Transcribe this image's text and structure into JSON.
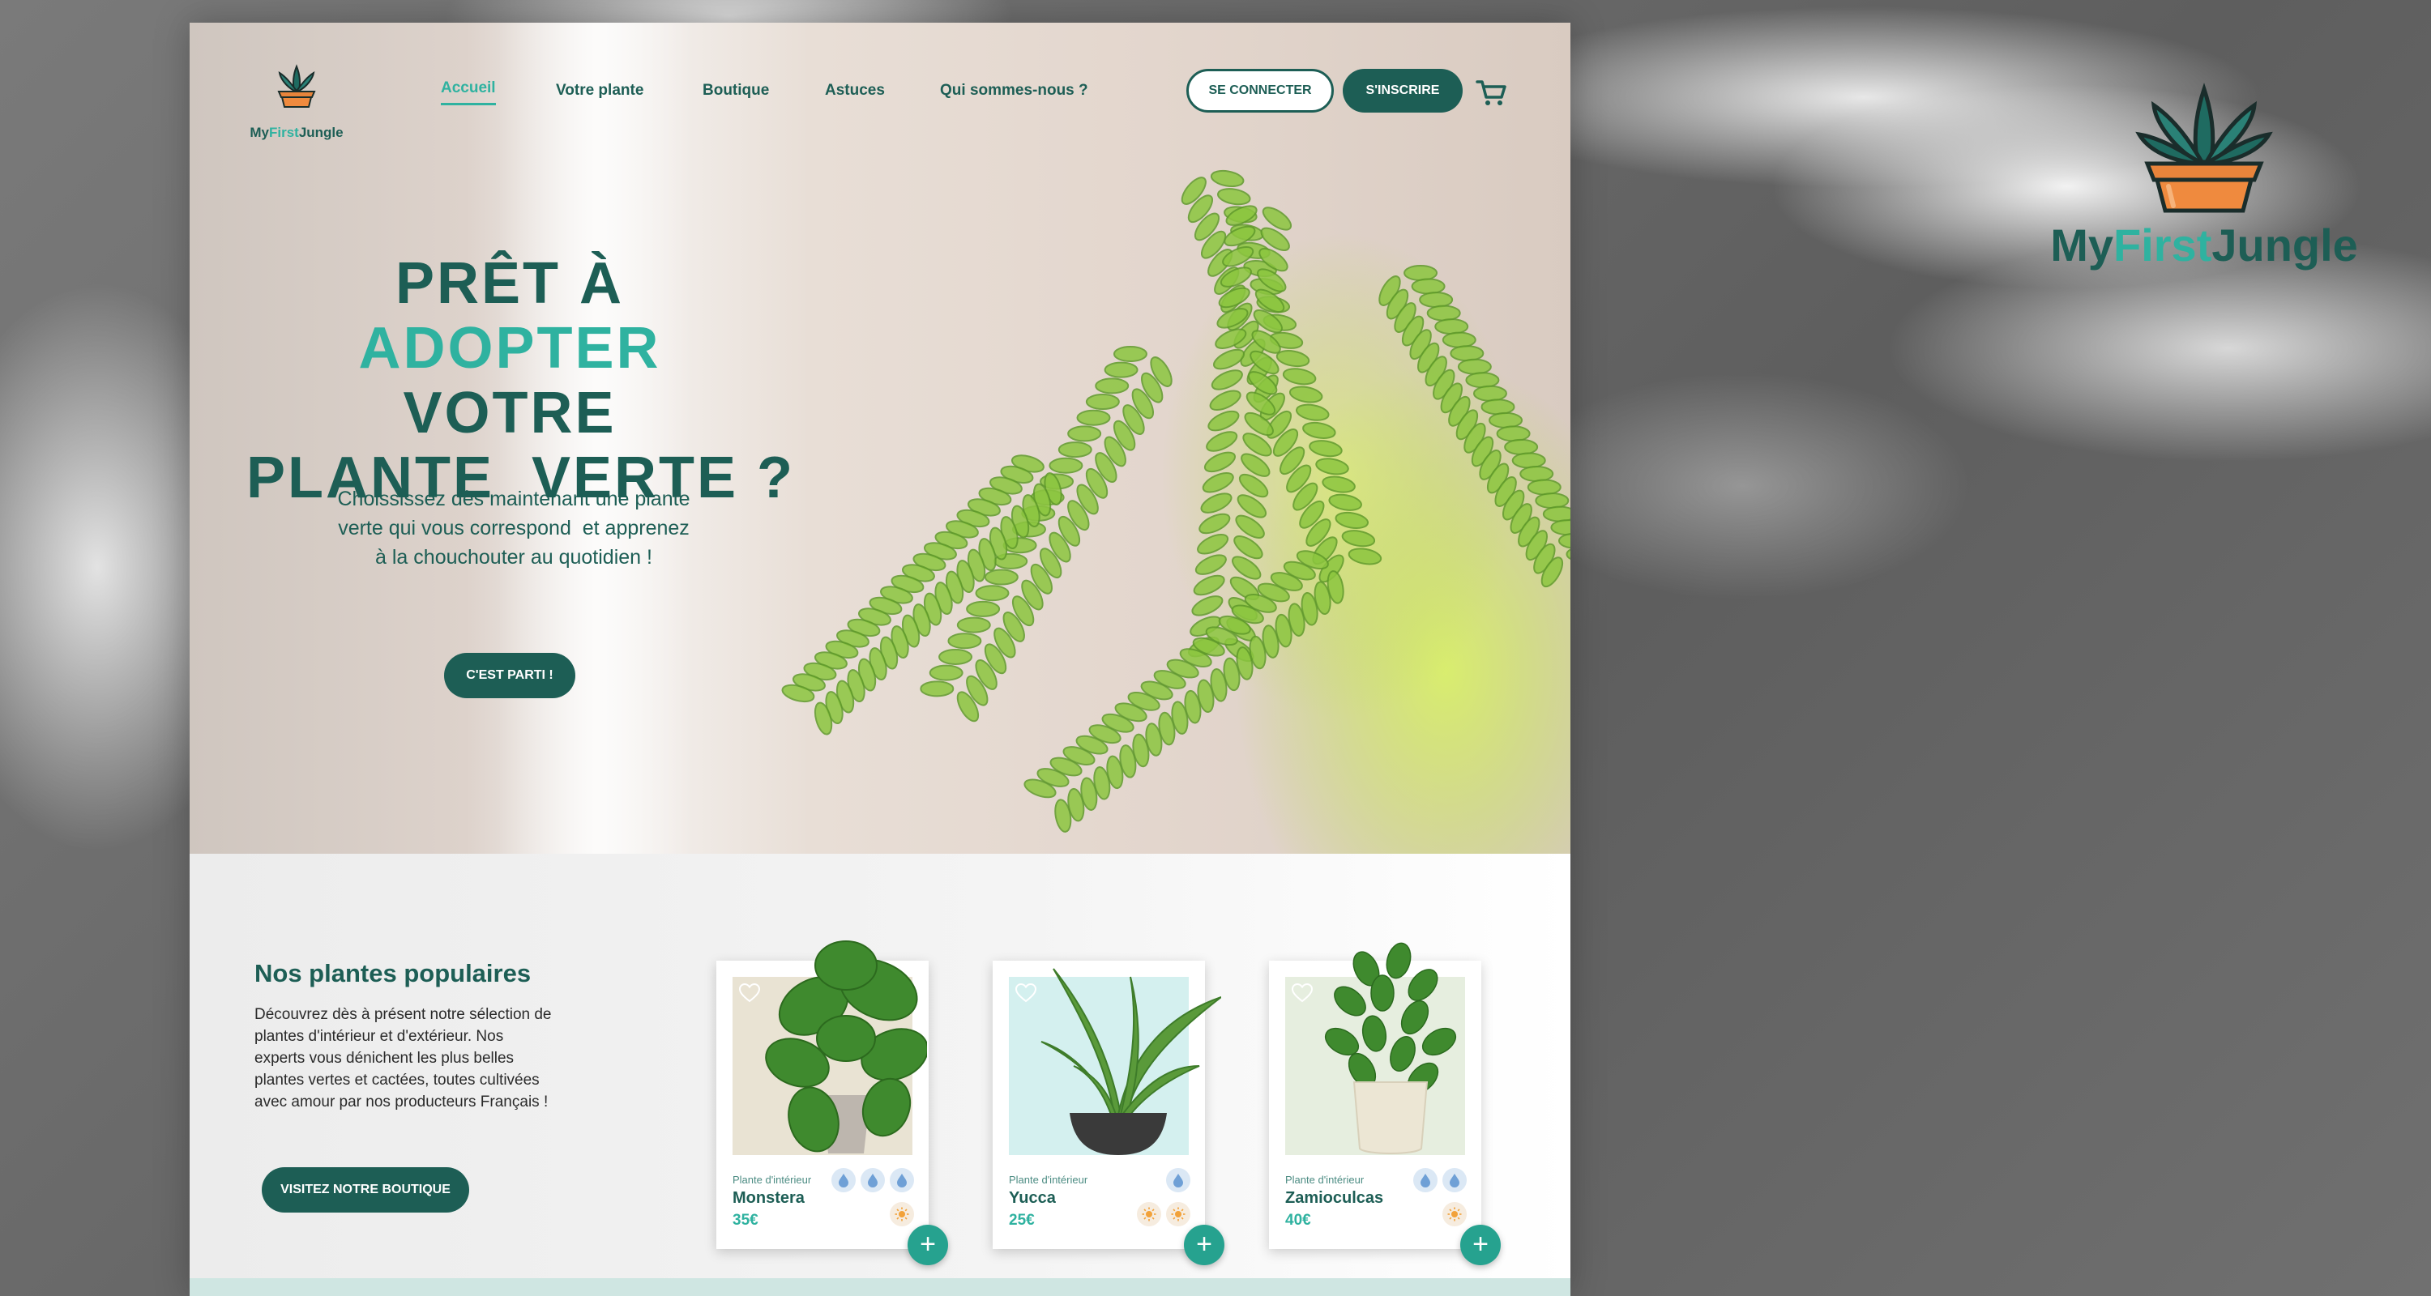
{
  "brand": {
    "name_part1": "My",
    "name_part2": "First",
    "name_part3": "Jungle"
  },
  "nav": {
    "items": [
      {
        "label": "Accueil",
        "active": true
      },
      {
        "label": "Votre plante",
        "active": false
      },
      {
        "label": "Boutique",
        "active": false
      },
      {
        "label": "Astuces",
        "active": false
      },
      {
        "label": "Qui sommes-nous ?",
        "active": false
      }
    ],
    "login_label": "SE CONNECTER",
    "signup_label": "S'INSCRIRE",
    "cart_icon": "cart-icon"
  },
  "hero": {
    "title_part1": "PRÊT À ",
    "title_accent": "ADOPTER",
    "title_line2": "VOTRE",
    "title_line3": "PLANTE  VERTE ?",
    "subtitle_line1": "Choississez dès maintenant une plante",
    "subtitle_line2": "verte qui vous correspond  et apprenez",
    "subtitle_line3": "à la chouchouter au quotidien !",
    "cta_label": "C'EST PARTI !"
  },
  "popular": {
    "title": "Nos plantes populaires",
    "desc_line1": "Découvrez dès à présent notre sélection de",
    "desc_line2": "plantes d'intérieur et d'extérieur. Nos",
    "desc_line3": "experts vous dénichent les plus belles",
    "desc_line4": "plantes vertes et cactées, toutes cultivées",
    "desc_line5": "avec amour par nos producteurs Français !",
    "shop_label": "VISITEZ NOTRE BOUTIQUE",
    "products": [
      {
        "category": "Plante d'intérieur",
        "name": "Monstera",
        "price": "35€",
        "water": 3,
        "sun": 1,
        "bg": "#e9e3d3"
      },
      {
        "category": "Plante d'intérieur",
        "name": "Yucca",
        "price": "25€",
        "water": 1,
        "sun": 2,
        "bg": "#d4f0ef"
      },
      {
        "category": "Plante d'intérieur",
        "name": "Zamioculcas",
        "price": "40€",
        "water": 2,
        "sun": 1,
        "bg": "#e6eedf"
      }
    ]
  },
  "colors": {
    "primary": "#1d5e55",
    "accent": "#2fb2a0",
    "add_button": "#26a28f"
  }
}
